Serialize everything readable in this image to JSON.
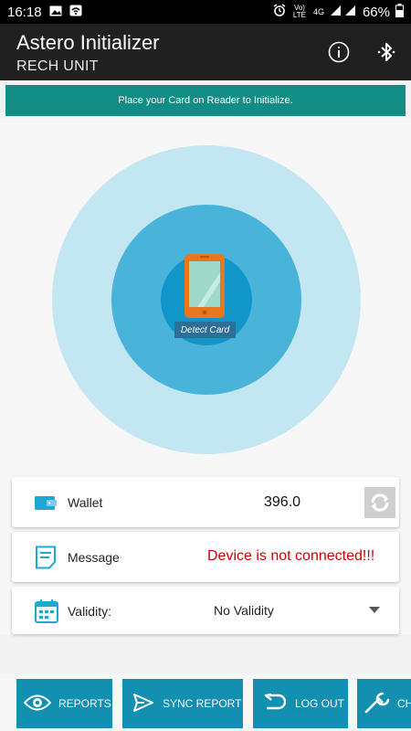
{
  "status_bar": {
    "time": "16:18",
    "network_label": "Vo) LTE",
    "network_type": "4G",
    "battery": "66%",
    "icons": [
      "image-icon",
      "wifi-signal-icon",
      "alarm-icon",
      "signal-bars-icon",
      "battery-icon"
    ]
  },
  "app_bar": {
    "title": "Astero Initializer",
    "subtitle": "RECH UNIT",
    "icons": [
      "info-icon",
      "bluetooth-icon"
    ]
  },
  "banner": {
    "text": "Place your Card on Reader to Initialize."
  },
  "reader": {
    "detect_label": "Detect Card",
    "icon": "phone-card-icon"
  },
  "wallet": {
    "label": "Wallet",
    "value": "396.0",
    "icon": "wallet-icon",
    "refresh_icon": "refresh-icon"
  },
  "message": {
    "label": "Message",
    "value": "Device is not connected!!!",
    "icon": "message-icon"
  },
  "validity": {
    "label": "Validity:",
    "value": "No Validity",
    "icon": "calendar-icon"
  },
  "bottom_buttons": [
    {
      "label": "REPORTS",
      "icon": "eye-icon"
    },
    {
      "label": "SYNC REPORT",
      "icon": "send-icon"
    },
    {
      "label": "LOG OUT",
      "icon": "return-arrow-icon"
    },
    {
      "label": "CH",
      "icon": "wrench-icon"
    }
  ],
  "colors": {
    "accent": "#128d86",
    "button": "#128fb1",
    "error": "#cc0000",
    "radar_outer": "#c2e6f2",
    "radar_middle": "#4ab3da",
    "radar_inner": "#1196c9",
    "phone": "#e8771e"
  }
}
